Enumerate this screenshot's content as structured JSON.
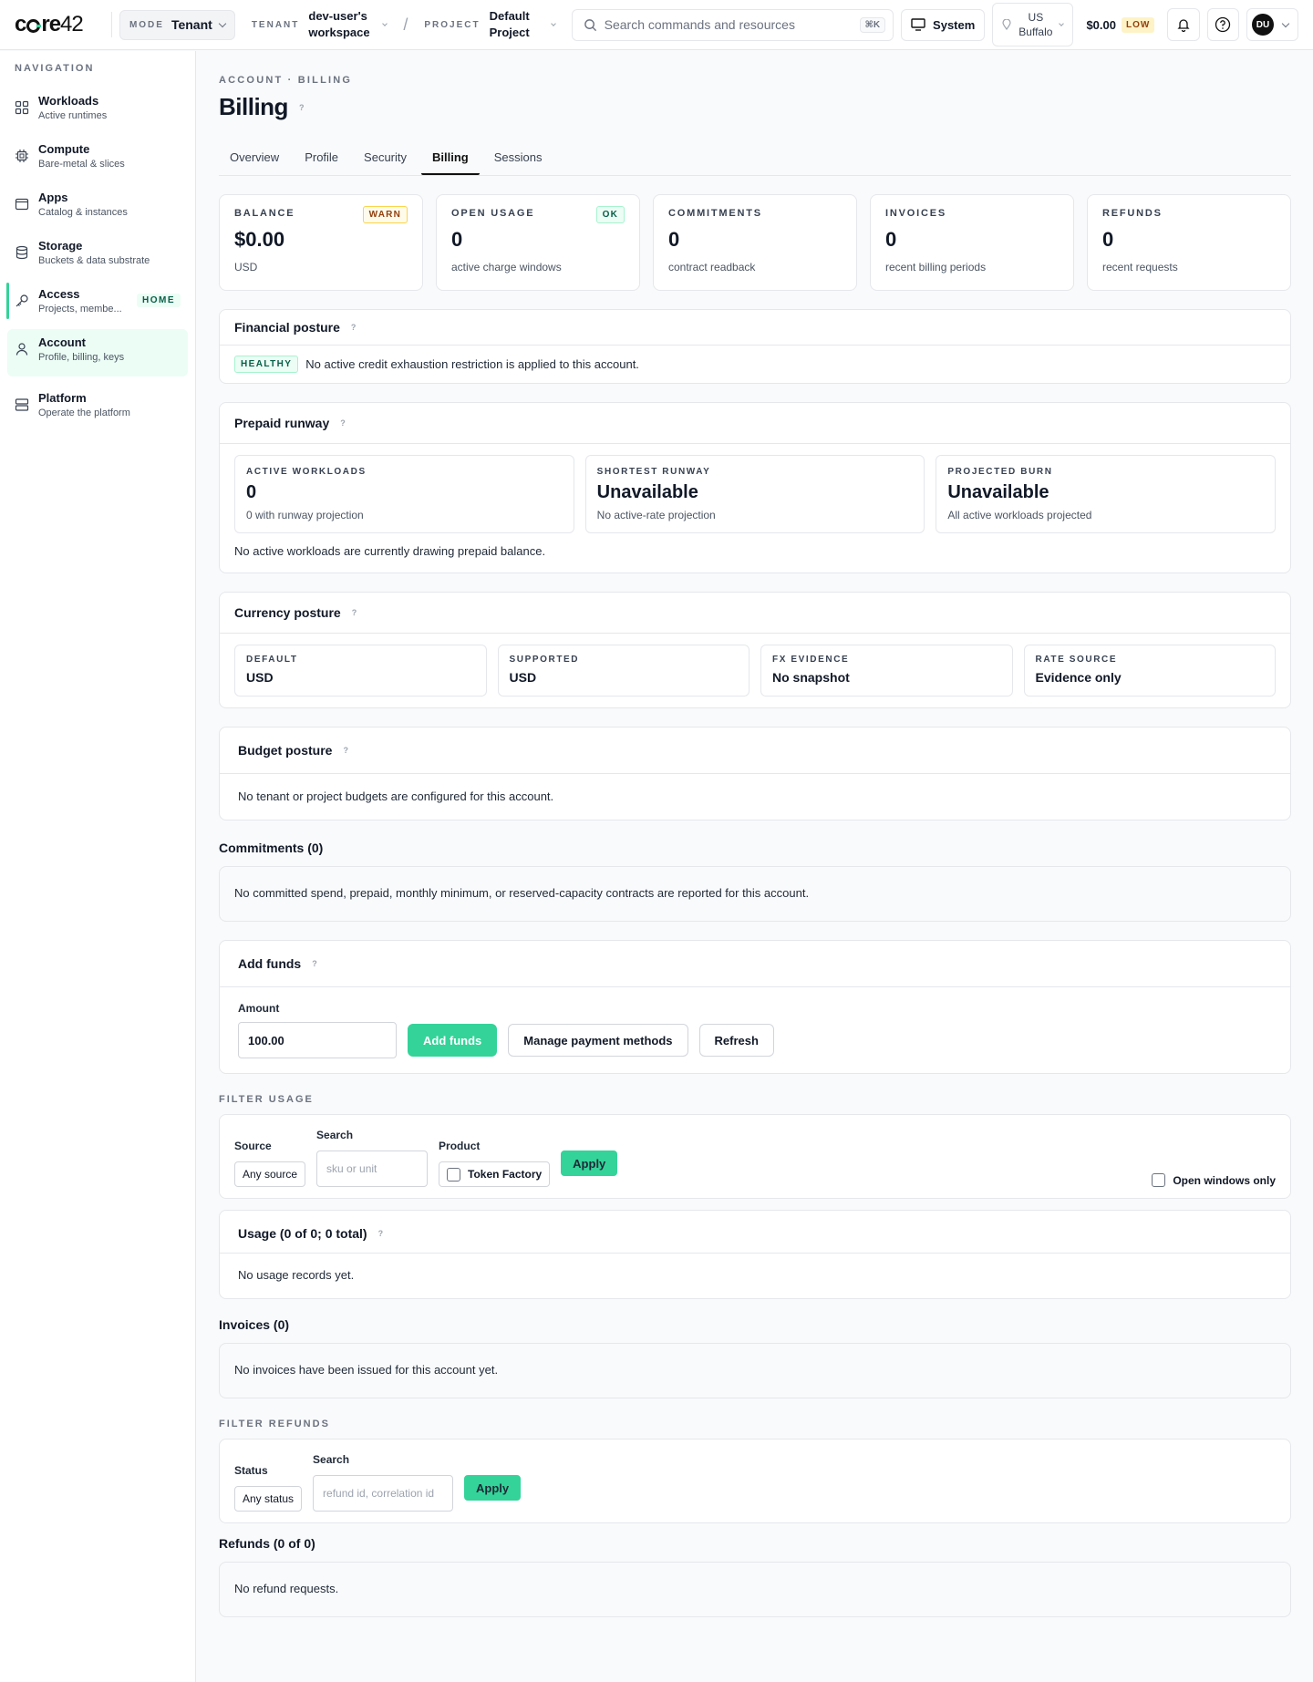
{
  "topbar": {
    "logo_a": "c",
    "logo_b": "re",
    "logo_c": "42",
    "mode_label": "MODE",
    "mode_value": "Tenant",
    "tenant_label": "TENANT",
    "tenant_value": "dev-user's workspace",
    "project_label": "PROJECT",
    "project_value": "Default Project",
    "search_placeholder": "Search commands and resources",
    "search_shortcut": "⌘K",
    "system_label": "System",
    "region_line1": "US",
    "region_line2": "Buffalo",
    "balance": "$0.00",
    "balance_badge": "LOW",
    "avatar_initials": "DU"
  },
  "sidebar": {
    "heading": "NAVIGATION",
    "items": [
      {
        "title": "Workloads",
        "sub": "Active runtimes",
        "icon": "grid-icon"
      },
      {
        "title": "Compute",
        "sub": "Bare-metal & slices",
        "icon": "chip-icon"
      },
      {
        "title": "Apps",
        "sub": "Catalog & instances",
        "icon": "window-icon"
      },
      {
        "title": "Storage",
        "sub": "Buckets & data substrate",
        "icon": "database-icon"
      },
      {
        "title": "Access",
        "sub": "Projects, membe...",
        "icon": "key-icon",
        "badge": "HOME"
      },
      {
        "title": "Account",
        "sub": "Profile, billing, keys",
        "icon": "user-icon"
      },
      {
        "title": "Platform",
        "sub": "Operate the platform",
        "icon": "server-icon"
      }
    ]
  },
  "page": {
    "breadcrumb": "ACCOUNT · BILLING",
    "title": "Billing",
    "help": "?",
    "tabs": [
      "Overview",
      "Profile",
      "Security",
      "Billing",
      "Sessions"
    ],
    "active_tab": "Billing"
  },
  "kpis": [
    {
      "label": "BALANCE",
      "value": "$0.00",
      "sub": "USD",
      "badge": "WARN"
    },
    {
      "label": "OPEN USAGE",
      "value": "0",
      "sub": "active charge windows",
      "badge": "OK"
    },
    {
      "label": "COMMITMENTS",
      "value": "0",
      "sub": "contract readback"
    },
    {
      "label": "INVOICES",
      "value": "0",
      "sub": "recent billing periods"
    },
    {
      "label": "REFUNDS",
      "value": "0",
      "sub": "recent requests"
    }
  ],
  "financial": {
    "title": "Financial posture",
    "badge": "HEALTHY",
    "text": "No active credit exhaustion restriction is applied to this account."
  },
  "runway": {
    "title": "Prepaid runway",
    "cards": [
      {
        "label": "ACTIVE WORKLOADS",
        "value": "0",
        "sub": "0 with runway projection"
      },
      {
        "label": "SHORTEST RUNWAY",
        "value": "Unavailable",
        "sub": "No active-rate projection"
      },
      {
        "label": "PROJECTED BURN",
        "value": "Unavailable",
        "sub": "All active workloads projected"
      }
    ],
    "note": "No active workloads are currently drawing prepaid balance."
  },
  "currency": {
    "title": "Currency posture",
    "cards": [
      {
        "label": "DEFAULT",
        "value": "USD"
      },
      {
        "label": "SUPPORTED",
        "value": "USD"
      },
      {
        "label": "FX EVIDENCE",
        "value": "No snapshot"
      },
      {
        "label": "RATE SOURCE",
        "value": "Evidence only"
      }
    ]
  },
  "budget": {
    "title": "Budget posture",
    "text": "No tenant or project budgets are configured for this account."
  },
  "commitments": {
    "title": "Commitments (0)",
    "text": "No committed spend, prepaid, monthly minimum, or reserved-capacity contracts are reported for this account."
  },
  "add_funds": {
    "title": "Add funds",
    "amount_label": "Amount",
    "amount_value": "100.00",
    "add_button": "Add funds",
    "manage_button": "Manage payment methods",
    "refresh_button": "Refresh"
  },
  "filter_usage": {
    "heading": "FILTER USAGE",
    "source_label": "Source",
    "source_value": "Any source",
    "search_label": "Search",
    "search_placeholder": "sku or unit",
    "product_label": "Product",
    "product_option": "Token Factory",
    "apply": "Apply",
    "open_only": "Open windows only"
  },
  "usage": {
    "title": "Usage (0 of 0; 0 total)",
    "text": "No usage records yet."
  },
  "invoices": {
    "title": "Invoices (0)",
    "text": "No invoices have been issued for this account yet."
  },
  "filter_refunds": {
    "heading": "FILTER REFUNDS",
    "status_label": "Status",
    "status_value": "Any status",
    "search_label": "Search",
    "search_placeholder": "refund id, correlation id",
    "apply": "Apply"
  },
  "refunds": {
    "title": "Refunds (0 of 0)",
    "text": "No refund requests."
  }
}
